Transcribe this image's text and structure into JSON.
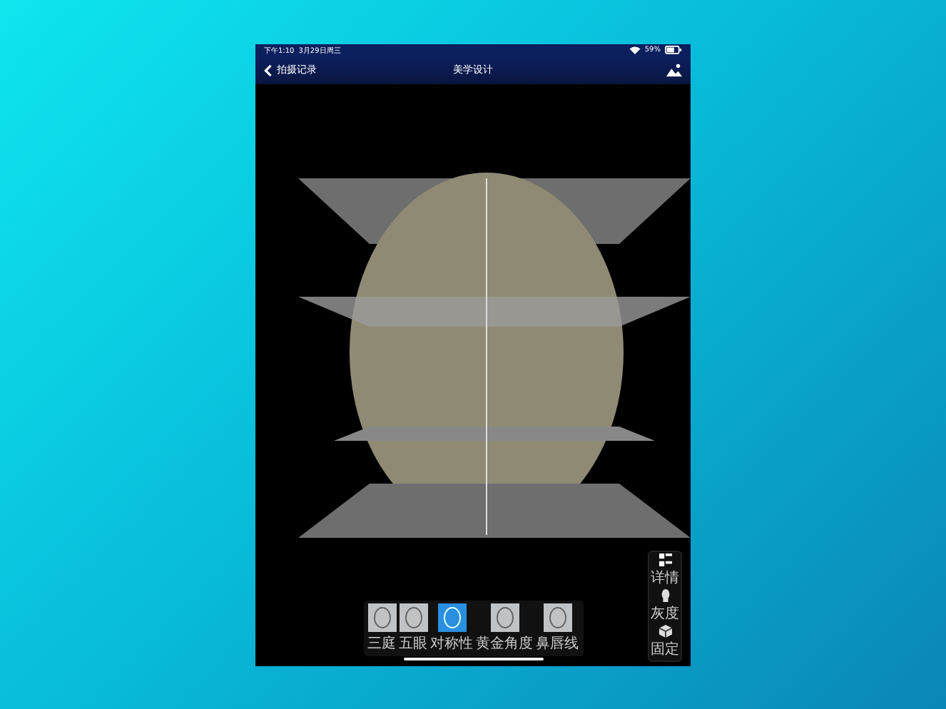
{
  "status_bar": {
    "time": "下午1:10",
    "date": "3月29日周三",
    "battery": "59%"
  },
  "nav": {
    "back_label": "拍摄记录",
    "title": "美学设计"
  },
  "thumbnails": [
    {
      "label": "三庭",
      "selected": false
    },
    {
      "label": "五眼",
      "selected": false
    },
    {
      "label": "对称性",
      "selected": true
    },
    {
      "label": "黄金角度",
      "selected": false
    },
    {
      "label": "鼻唇线",
      "selected": false
    }
  ],
  "side_tools": [
    {
      "kind": "details",
      "label": "详情"
    },
    {
      "kind": "gray",
      "label": "灰度"
    },
    {
      "kind": "fixed",
      "label": "固定"
    }
  ]
}
